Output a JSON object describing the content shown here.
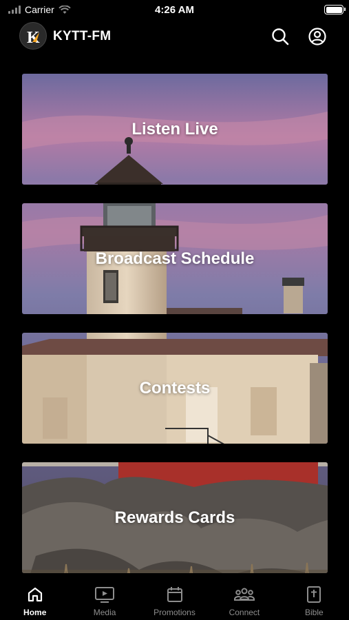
{
  "status_bar": {
    "carrier": "Carrier",
    "time": "4:26 AM"
  },
  "header": {
    "title": "KYTT-FM",
    "logo_letter": "K",
    "icons": [
      "search-icon",
      "profile-icon"
    ]
  },
  "cards": [
    {
      "label": "Listen Live"
    },
    {
      "label": "Broadcast Schedule"
    },
    {
      "label": "Contests"
    },
    {
      "label": "Rewards Cards"
    }
  ],
  "tabs": [
    {
      "label": "Home",
      "icon": "home-icon",
      "active": true
    },
    {
      "label": "Media",
      "icon": "tv-icon",
      "active": false
    },
    {
      "label": "Promotions",
      "icon": "calendar-icon",
      "active": false
    },
    {
      "label": "Connect",
      "icon": "people-icon",
      "active": false
    },
    {
      "label": "Bible",
      "icon": "bible-icon",
      "active": false
    }
  ],
  "colors": {
    "background": "#000000",
    "active_tab": "#ffffff",
    "inactive_tab": "#8e8e8e",
    "logo_accent": "#f5a623"
  }
}
